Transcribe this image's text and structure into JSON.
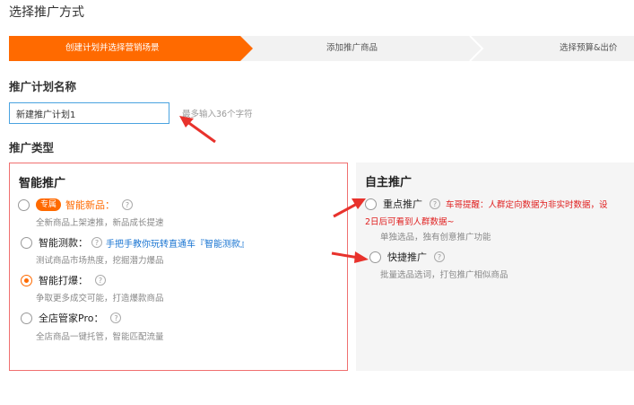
{
  "page": {
    "title": "选择推广方式"
  },
  "steps": [
    {
      "label": "创建计划并选择营销场景",
      "active": true
    },
    {
      "label": "添加推广商品",
      "active": false
    },
    {
      "label": "选择预算&出价",
      "active": false
    }
  ],
  "plan_name": {
    "label": "推广计划名称",
    "value": "新建推广计划1",
    "hint": "最多输入36个字符"
  },
  "promo_type": {
    "label": "推广类型"
  },
  "smart": {
    "title": "智能推广",
    "options": [
      {
        "badge": "专属",
        "label": "智能新品：",
        "desc": "全新商品上架速推，新品成长提速",
        "checked": false
      },
      {
        "label": "智能测款：",
        "link": "手把手教你玩转直通车『智能测款』",
        "desc": "测试商品市场热度，挖掘潜力爆品",
        "checked": false
      },
      {
        "label": "智能打爆：",
        "desc": "争取更多成交可能，打造爆款商品",
        "checked": true
      },
      {
        "label": "全店管家Pro：",
        "desc": "全店商品一键托管，智能匹配流量",
        "checked": false
      }
    ]
  },
  "self": {
    "title": "自主推广",
    "options": [
      {
        "label": "重点推广",
        "warning": "车哥提醒：人群定向数据为非实时数据，设",
        "warning_cont": "2日后可看到人群数据~",
        "desc": "单独选品，独有创意推广功能",
        "checked": false
      },
      {
        "label": "快捷推广",
        "desc": "批量选品选词，打包推广相似商品",
        "checked": false
      }
    ]
  },
  "colors": {
    "accent": "#ff6a00",
    "smart_border": "#f07070",
    "link": "#1a75d2",
    "warning": "#e02020",
    "arrow": "#e8322c"
  },
  "icons": {
    "help": "?"
  }
}
